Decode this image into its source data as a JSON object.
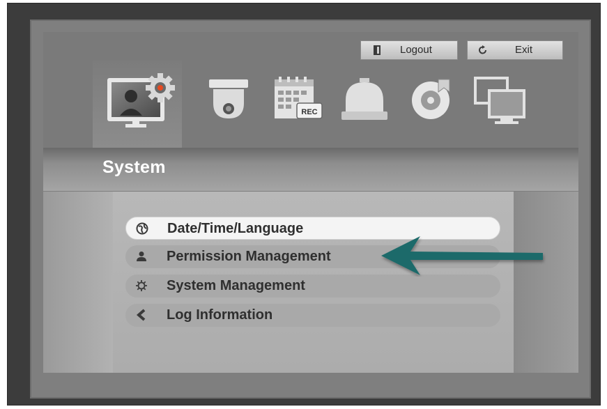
{
  "toolbar": {
    "logout_label": "Logout",
    "exit_label": "Exit"
  },
  "tabs": [
    {
      "icon": "system-settings-icon",
      "selected": true
    },
    {
      "icon": "dome-camera-icon"
    },
    {
      "icon": "record-calendar-icon",
      "badge": "REC"
    },
    {
      "icon": "event-alarm-icon"
    },
    {
      "icon": "backup-disc-icon"
    },
    {
      "icon": "network-monitors-icon"
    }
  ],
  "section_title": "System",
  "menu": {
    "items": [
      {
        "label": "Date/Time/Language",
        "icon": "globe-icon",
        "selected": true
      },
      {
        "label": "Permission Management",
        "icon": "user-icon"
      },
      {
        "label": "System Management",
        "icon": "gear-icon"
      },
      {
        "label": "Log Information",
        "icon": "log-icon"
      }
    ]
  },
  "colors": {
    "accent_arrow": "#1f6b6b",
    "selected_item": "#f4f4f4",
    "frame": "#3c3c3c"
  }
}
